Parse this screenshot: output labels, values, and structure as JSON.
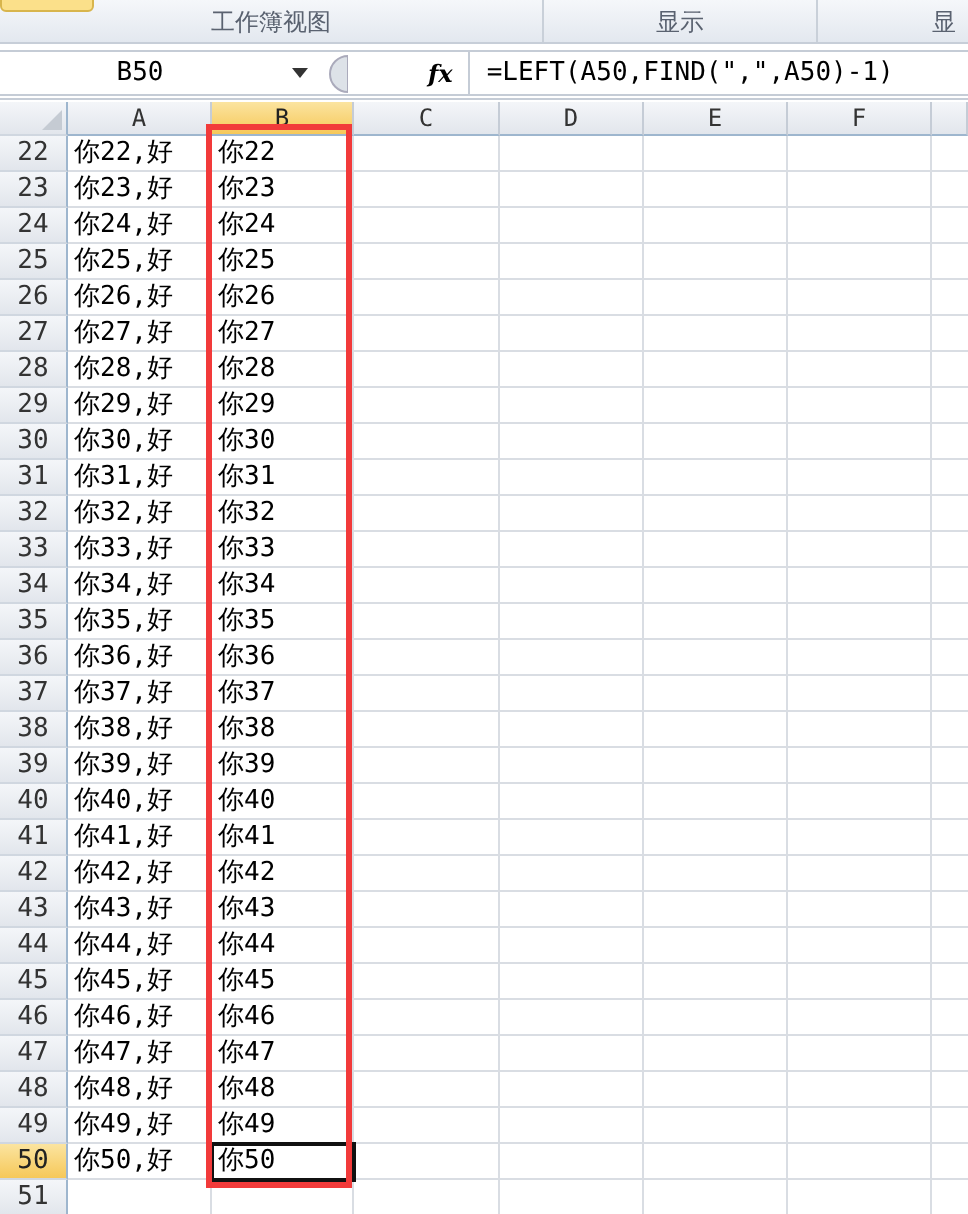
{
  "ribbon": {
    "groups": [
      {
        "label": "工作簿视图"
      },
      {
        "label": "显示"
      },
      {
        "label": "显"
      }
    ]
  },
  "formula_bar": {
    "name_box": "B50",
    "function_label": "fx",
    "formula": "=LEFT(A50,FIND(\",\",A50)-1)"
  },
  "columns": [
    {
      "label": "A",
      "selected": false
    },
    {
      "label": "B",
      "selected": true
    },
    {
      "label": "C",
      "selected": false
    },
    {
      "label": "D",
      "selected": false
    },
    {
      "label": "E",
      "selected": false
    },
    {
      "label": "F",
      "selected": false
    }
  ],
  "rows": [
    {
      "number": "22",
      "a": "你22,好",
      "b": "你22",
      "selected": false
    },
    {
      "number": "23",
      "a": "你23,好",
      "b": "你23",
      "selected": false
    },
    {
      "number": "24",
      "a": "你24,好",
      "b": "你24",
      "selected": false
    },
    {
      "number": "25",
      "a": "你25,好",
      "b": "你25",
      "selected": false
    },
    {
      "number": "26",
      "a": "你26,好",
      "b": "你26",
      "selected": false
    },
    {
      "number": "27",
      "a": "你27,好",
      "b": "你27",
      "selected": false
    },
    {
      "number": "28",
      "a": "你28,好",
      "b": "你28",
      "selected": false
    },
    {
      "number": "29",
      "a": "你29,好",
      "b": "你29",
      "selected": false
    },
    {
      "number": "30",
      "a": "你30,好",
      "b": "你30",
      "selected": false
    },
    {
      "number": "31",
      "a": "你31,好",
      "b": "你31",
      "selected": false
    },
    {
      "number": "32",
      "a": "你32,好",
      "b": "你32",
      "selected": false
    },
    {
      "number": "33",
      "a": "你33,好",
      "b": "你33",
      "selected": false
    },
    {
      "number": "34",
      "a": "你34,好",
      "b": "你34",
      "selected": false
    },
    {
      "number": "35",
      "a": "你35,好",
      "b": "你35",
      "selected": false
    },
    {
      "number": "36",
      "a": "你36,好",
      "b": "你36",
      "selected": false
    },
    {
      "number": "37",
      "a": "你37,好",
      "b": "你37",
      "selected": false
    },
    {
      "number": "38",
      "a": "你38,好",
      "b": "你38",
      "selected": false
    },
    {
      "number": "39",
      "a": "你39,好",
      "b": "你39",
      "selected": false
    },
    {
      "number": "40",
      "a": "你40,好",
      "b": "你40",
      "selected": false
    },
    {
      "number": "41",
      "a": "你41,好",
      "b": "你41",
      "selected": false
    },
    {
      "number": "42",
      "a": "你42,好",
      "b": "你42",
      "selected": false
    },
    {
      "number": "43",
      "a": "你43,好",
      "b": "你43",
      "selected": false
    },
    {
      "number": "44",
      "a": "你44,好",
      "b": "你44",
      "selected": false
    },
    {
      "number": "45",
      "a": "你45,好",
      "b": "你45",
      "selected": false
    },
    {
      "number": "46",
      "a": "你46,好",
      "b": "你46",
      "selected": false
    },
    {
      "number": "47",
      "a": "你47,好",
      "b": "你47",
      "selected": false
    },
    {
      "number": "48",
      "a": "你48,好",
      "b": "你48",
      "selected": false
    },
    {
      "number": "49",
      "a": "你49,好",
      "b": "你49",
      "selected": false
    },
    {
      "number": "50",
      "a": "你50,好",
      "b": "你50",
      "selected": true
    },
    {
      "number": "51",
      "selected": false
    }
  ]
}
